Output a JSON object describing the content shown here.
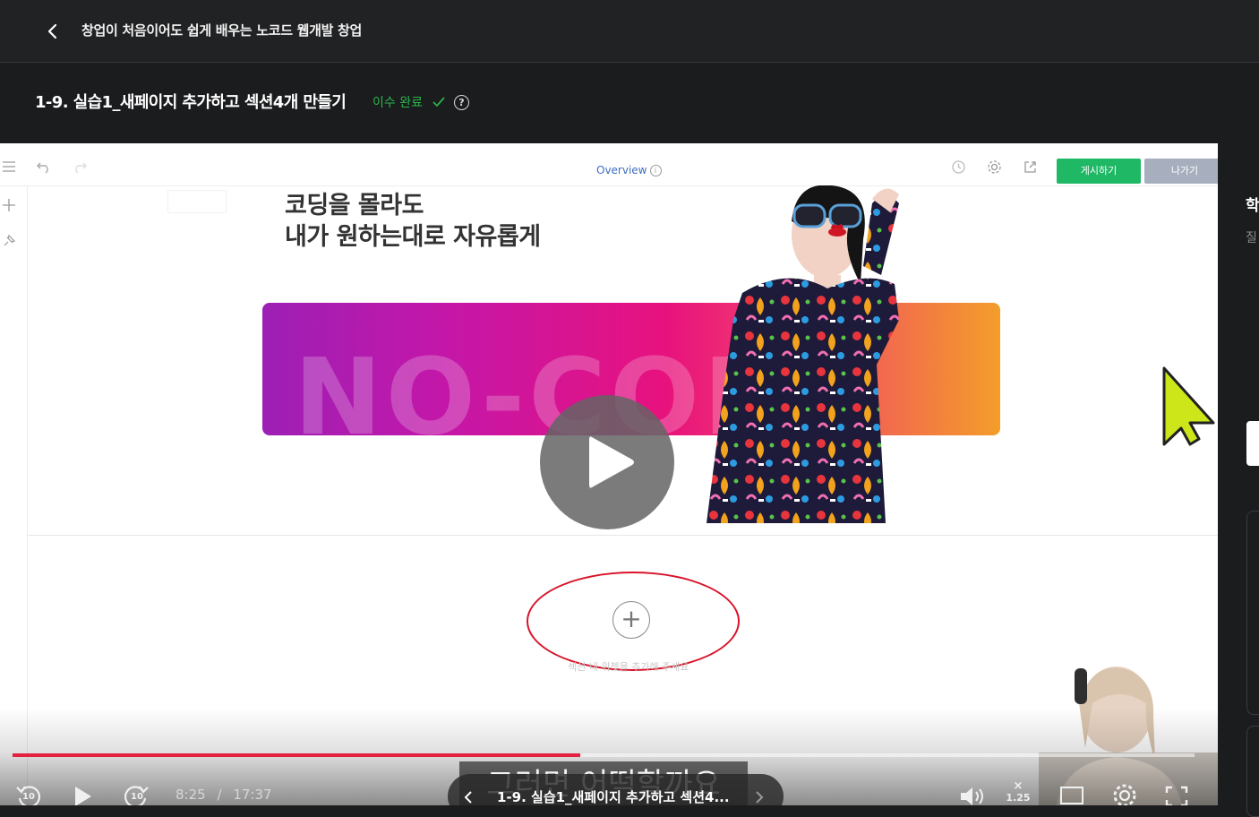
{
  "header": {
    "back_icon": "chevron-left-icon",
    "course_title": "창업이 처음이어도 쉽게 배우는 노코드 웹개발 창업"
  },
  "lesson": {
    "title": "1-9. 실습1_새페이지 추가하고 섹션4개 만들기",
    "status": "이수 완료",
    "status_color": "#2ab54a",
    "help_icon": "question-circle-icon"
  },
  "editor": {
    "overview_label": "Overview",
    "publish_label": "게시하기",
    "exit_label": "나가기",
    "hero_line1": "코딩을 몰라도",
    "hero_line2": "내가 원하는대로 자유롭게",
    "banner_text": "NO-CODE",
    "add_section_hint": "섹션 내 위젯을 추가해 주세요"
  },
  "player": {
    "current_time": "8:25",
    "separator": "/",
    "total_time": "17:37",
    "progress": 0.48,
    "subtitle": "그러면 어떡할까요",
    "nav_title": "1-9. 실습1_새페이지 추가하고 섹션4...",
    "rewind_label": "10",
    "forward_label": "10",
    "speed_label": "1.25",
    "accent_color": "#e3223f"
  },
  "side_panel": {
    "title_char": "학",
    "sub_char": "질"
  }
}
